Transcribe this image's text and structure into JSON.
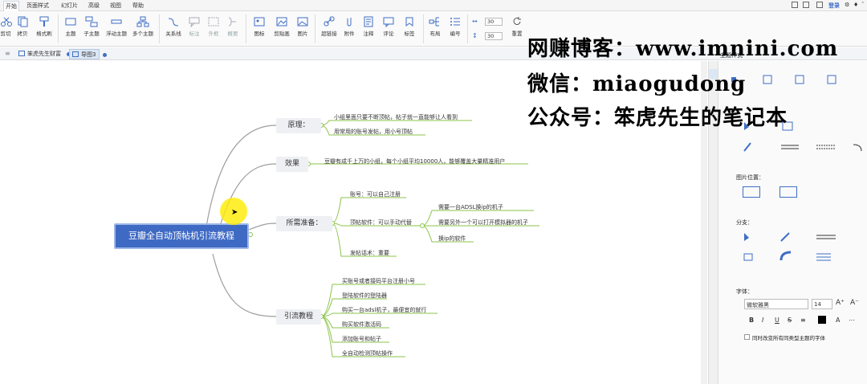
{
  "menu": {
    "tabs": [
      "开始",
      "页面样式",
      "幻灯片",
      "高级",
      "视图",
      "帮助"
    ],
    "right_login": "登录"
  },
  "toolbar": {
    "clipboard": [
      "剪切",
      "拷贝",
      "格式刷"
    ],
    "topic": [
      "主题",
      "子主题",
      "浮动主题",
      "多个主题"
    ],
    "relation": [
      "关系线",
      "标注",
      "外框",
      "概要"
    ],
    "insert": [
      "图标",
      "剪贴画",
      "图片"
    ],
    "attach": [
      "超链接",
      "附件",
      "注释",
      "评论",
      "标签"
    ],
    "layout": [
      "布局",
      "编号"
    ],
    "spacing_h": "30",
    "spacing_v": "30",
    "reset": "重置"
  },
  "doctabs": [
    "笨虎先生财富",
    "导图3"
  ],
  "watermark": {
    "line1": "网赚博客：www.imnini.com",
    "line2": "微信：miaogudong",
    "line3": "公众号：笨虎先生的笔记本"
  },
  "mindmap": {
    "central": "豆瓣全自动顶帖机引流教程",
    "branches": [
      {
        "label": "原理：",
        "children": [
          "小组里面只要不断顶帖，帖子就一直能够让人看到",
          "用常用的账号发帖，用小号顶帖"
        ]
      },
      {
        "label": "效果",
        "children": [
          "豆瓣有成千上万的小组，每个小组平均10000人，能够覆盖大量精准用户"
        ]
      },
      {
        "label": "所需准备：",
        "children": [
          "账号：可以自己注册",
          "顶帖软件：可以手动代替",
          "发帖话术：重要"
        ],
        "sub": [
          "需要一台ADSL换ip的机子",
          "需要另外一个可以打开模拟器的机子",
          "换ip的软件"
        ]
      },
      {
        "label": "引流教程",
        "children": [
          "买账号或者接码平台注册小号",
          "登陆软件的登陆器",
          "购买一台adsl机子，最便宜的就行",
          "购买软件激活码",
          "添加账号和帖子",
          "全自动检测顶帖操作"
        ]
      }
    ]
  },
  "panel": {
    "title": "主题样式",
    "image_pos": "图片位置：",
    "branch": "分支：",
    "font": "字体：",
    "font_name": "微软雅黑",
    "font_size": "14",
    "font_btns": [
      "B",
      "I",
      "U",
      "S"
    ],
    "apply_all": "同时改变所有同类型主题的字体"
  },
  "colors": {
    "central_bg": "#3f6ac4",
    "accent": "#3f6fc6",
    "branch_line": "#9e9e9e",
    "leaf_line": "#8bc34a"
  }
}
